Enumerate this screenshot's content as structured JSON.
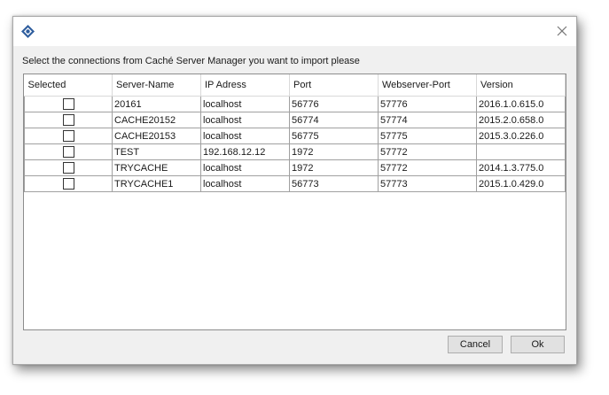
{
  "window": {
    "app_icon": "diamond-app-icon",
    "close_icon": "close-icon"
  },
  "prompt": "Select the connections from Caché Server Manager you want to import please",
  "table": {
    "columns": [
      "Selected",
      "Server-Name",
      "IP Adress",
      "Port",
      "Webserver-Port",
      "Version"
    ],
    "rows": [
      {
        "selected": false,
        "server_name": "20161",
        "ip": "localhost",
        "port": "56776",
        "webserver_port": "57776",
        "version": "2016.1.0.615.0"
      },
      {
        "selected": false,
        "server_name": "CACHE20152",
        "ip": "localhost",
        "port": "56774",
        "webserver_port": "57774",
        "version": "2015.2.0.658.0"
      },
      {
        "selected": false,
        "server_name": "CACHE20153",
        "ip": "localhost",
        "port": "56775",
        "webserver_port": "57775",
        "version": "2015.3.0.226.0"
      },
      {
        "selected": false,
        "server_name": "TEST",
        "ip": "192.168.12.12",
        "port": "1972",
        "webserver_port": "57772",
        "version": ""
      },
      {
        "selected": false,
        "server_name": "TRYCACHE",
        "ip": "localhost",
        "port": "1972",
        "webserver_port": "57772",
        "version": "2014.1.3.775.0"
      },
      {
        "selected": false,
        "server_name": "TRYCACHE1",
        "ip": "localhost",
        "port": "56773",
        "webserver_port": "57773",
        "version": "2015.1.0.429.0"
      }
    ]
  },
  "buttons": {
    "cancel": "Cancel",
    "ok": "Ok"
  }
}
